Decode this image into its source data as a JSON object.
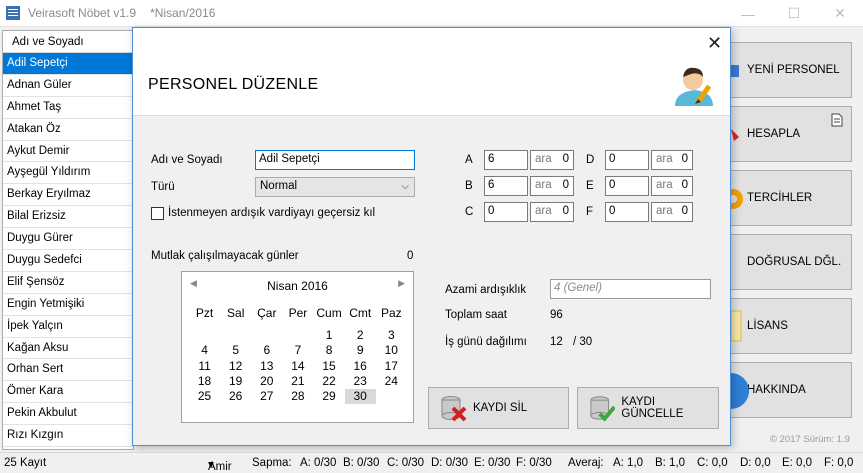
{
  "window": {
    "app_title": "Veirasoft Nöbet v1.9",
    "file_title": "*Nisan/2016"
  },
  "list": {
    "header": "Adı ve Soyadı",
    "items": [
      "Adil Sepetçi",
      "Adnan Güler",
      "Ahmet Taş",
      "Atakan Öz",
      "Aykut Demir",
      "Ayşegül Yıldırım",
      "Berkay Eryılmaz",
      "Bilal Erizsiz",
      "Duygu Gürer",
      "Duygu Sedefci",
      "Elif Şensöz",
      "Engin Yetmişiki",
      "İpek Yalçın",
      "Kağan Aksu",
      "Orhan Sert",
      "Ömer Kara",
      "Pekin Akbulut",
      "Rızı Kızgın"
    ],
    "selected_index": 0
  },
  "side_buttons": [
    {
      "label": "YENİ PERSONEL",
      "icon": "person-add-icon"
    },
    {
      "label": "HESAPLA",
      "icon": "calculator-icon"
    },
    {
      "label": "TERCİHLER",
      "icon": "gear-icon"
    },
    {
      "label": "DOĞRUSAL DĞL.",
      "icon": "chart-icon"
    },
    {
      "label": "LİSANS",
      "icon": "license-icon"
    },
    {
      "label": "HAKKINDA",
      "icon": "info-icon"
    }
  ],
  "copyright": "© 2017 Sürüm: 1.9",
  "dialog": {
    "title": "PERSONEL DÜZENLE",
    "close": "✕",
    "name_label": "Adı ve Soyadı",
    "name_value": "Adil Sepetçi",
    "type_label": "Türü",
    "type_value": "Normal",
    "checkbox_label": "İstenmeyen ardışık vardiyayı geçersiz kıl",
    "unavailable_label": "Mutlak çalışılmayacak günler",
    "unavailable_count": "0",
    "shifts": [
      {
        "label": "A",
        "value": "6",
        "ara_label": "ara",
        "ara_value": "0"
      },
      {
        "label": "B",
        "value": "6",
        "ara_label": "ara",
        "ara_value": "0"
      },
      {
        "label": "C",
        "value": "0",
        "ara_label": "ara",
        "ara_value": "0"
      },
      {
        "label": "D",
        "value": "0",
        "ara_label": "ara",
        "ara_value": "0"
      },
      {
        "label": "E",
        "value": "0",
        "ara_label": "ara",
        "ara_value": "0"
      },
      {
        "label": "F",
        "value": "0",
        "ara_label": "ara",
        "ara_value": "0"
      }
    ],
    "max_consecutive_label": "Azami ardışıklık",
    "max_consecutive_placeholder": "4 (Genel)",
    "total_hours_label": "Toplam saat",
    "total_hours_value": "96",
    "workday_label": "İş günü dağılımı",
    "workday_value": "12",
    "workday_total": "/ 30",
    "calendar": {
      "month_title": "Nisan 2016",
      "prev": "◀",
      "next": "▶",
      "weekdays": [
        "Pzt",
        "Sal",
        "Çar",
        "Per",
        "Cum",
        "Cmt",
        "Paz"
      ],
      "weeks": [
        [
          "",
          "",
          "",
          "",
          "1",
          "2",
          "3"
        ],
        [
          "4",
          "5",
          "6",
          "7",
          "8",
          "9",
          "10"
        ],
        [
          "11",
          "12",
          "13",
          "14",
          "15",
          "16",
          "17"
        ],
        [
          "18",
          "19",
          "20",
          "21",
          "22",
          "23",
          "24"
        ],
        [
          "25",
          "26",
          "27",
          "28",
          "29",
          "30",
          ""
        ]
      ],
      "highlighted_day": "30"
    },
    "delete_button": "KAYDI SİL",
    "update_button": "KAYDI GÜNCELLE"
  },
  "status": {
    "record_count": "25 Kayıt",
    "amir": "Amir",
    "sapma_label": "Sapma:",
    "sapma": [
      "A: 0/30",
      "B: 0/30",
      "C: 0/30",
      "D: 0/30",
      "E: 0/30",
      "F: 0/30"
    ],
    "averaj_label": "Averaj:",
    "averaj": [
      "A: 1,0",
      "B: 1,0",
      "C: 0,0",
      "D: 0,0",
      "E: 0,0",
      "F: 0,0"
    ]
  }
}
